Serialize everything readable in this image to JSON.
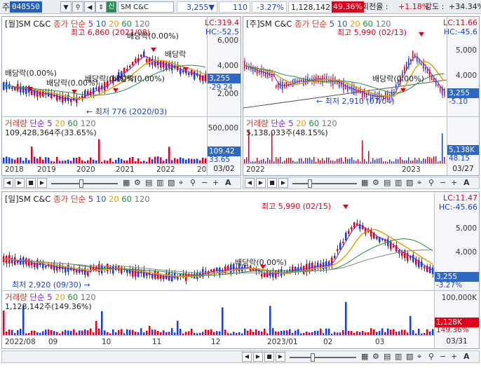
{
  "topbar": {
    "label": "주",
    "code": "048550",
    "sin": "신",
    "name": "SM C&C",
    "price": "3,255",
    "change": "110",
    "change_pct": "-3.27%",
    "volume": "1,128,142",
    "vol_pct": "49.36%",
    "turnover_label": "회전율 :",
    "turnover": "+1.18%",
    "strength_label": "강도 :",
    "strength": "+34.34%",
    "colors": {
      "up": "#e0001b",
      "down": "#1a3fd6"
    }
  },
  "monthly": {
    "header_name": "[월]SM C&C",
    "ma_labels": [
      "종가 단순",
      "5",
      "10",
      "20",
      "60",
      "120"
    ],
    "lc": "LC:319.4",
    "hc": "HC:-52.5",
    "annotations": {
      "high": "최고 6,860 (2021/08)",
      "low": "최저 776 (2020/03)",
      "div1": "배당락(0.00%)",
      "div2": "배당락(0.00%)",
      "div3": "배당락(0.00%)",
      "div4": "배당락(0.00%)",
      "div5": "배당락(0.00%)",
      "div6": "배당락"
    },
    "price_ticks": [
      "6,000",
      "4,000",
      "2,000"
    ],
    "price_tag": "3,255",
    "pct_tag": "-29.24",
    "volume_header": "거래량 단순 5 20 60 120",
    "volume_value": "109,428,364주(33.65%)",
    "volume_ticks": [
      "500,000"
    ],
    "volume_tag": "109.42",
    "volume_pct_tag": "33.65",
    "x_ticks": [
      "2018",
      "2019",
      "2020",
      "2021",
      "2022",
      "202"
    ],
    "date": "03/02"
  },
  "weekly": {
    "header_name": "[주]SM C&C",
    "ma_labels": [
      "종가 단순",
      "5",
      "10",
      "20",
      "60",
      "120"
    ],
    "lc": "LC:11.66",
    "hc": "HC:-45.6",
    "annotations": {
      "high": "최고 5,990 (02/13)",
      "low": "최저 2,910 (07/04)",
      "div": "배당락(0.00%)"
    },
    "price_ticks": [
      "5,000",
      "4,000",
      "3,000"
    ],
    "price_tag": "3,255",
    "pct_tag": "-5.10",
    "volume_header": "거래량 단순 5 20 60 120",
    "volume_value": "5,138,033주(48.15%)",
    "volume_tag": "5,138K",
    "volume_pct_tag": "48.15",
    "x_ticks": [
      "2022",
      "2023"
    ],
    "date": "03/27"
  },
  "daily": {
    "header_name": "[일]SM C&C",
    "ma_labels": [
      "종가 단순",
      "5",
      "10",
      "20",
      "60",
      "120"
    ],
    "lc": "LC:11.47",
    "hc": "HC:-45.66",
    "annotations": {
      "high": "최고 5,990 (02/15)",
      "low": "최저 2,920 (09/30)",
      "div": "배당락(0.00%)"
    },
    "price_ticks": [
      "5,000",
      "4,000",
      "3,000"
    ],
    "price_tag": "3,255",
    "pct_tag": "-3.27%",
    "volume_header": "거래량 단순 5 20 60 120",
    "volume_value": "1,128,142주(149.36%)",
    "volume_ticks": [
      "100,000K"
    ],
    "volume_tag": "1,128K",
    "volume_pct_tag": "149.36%",
    "x_ticks": [
      "2022/08",
      "09",
      "10",
      "11",
      "12",
      "2023/01",
      "02",
      "03"
    ],
    "date": "03/31"
  },
  "toolbar": {
    "icons": [
      "prev-icon",
      "play-icon",
      "stop-icon",
      "next-icon",
      "zoom-slider",
      "table-icon",
      "settings-icon",
      "grid-icon",
      "indicator-icon",
      "crosshair-icon",
      "search-icon",
      "minus-icon",
      "plus-icon",
      "text-icon"
    ],
    "text_label": "A"
  }
}
